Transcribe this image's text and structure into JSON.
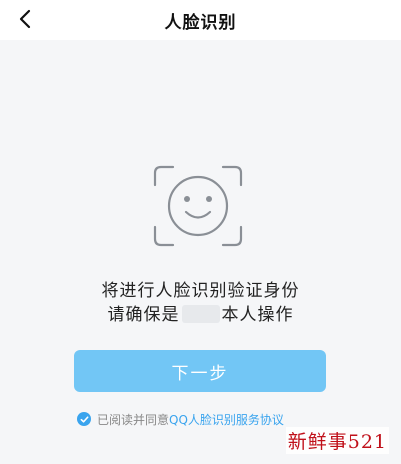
{
  "nav": {
    "title": "人脸识别",
    "back_icon": "chevron-left-icon"
  },
  "face_icon": "face-scan-icon",
  "instructions": {
    "line1": "将进行人脸识别验证身份",
    "line2_prefix": "请确保是",
    "line2_suffix": "本人操作"
  },
  "next_button": {
    "label": "下一步"
  },
  "agreement": {
    "prefix": "已阅读并同意",
    "link": "QQ人脸识别服务协议",
    "check_icon": "check-circle-icon"
  },
  "watermark": "新鲜事521",
  "colors": {
    "accent": "#3aa4ee",
    "button": "#72c6f5",
    "background": "#f5f6f8"
  }
}
